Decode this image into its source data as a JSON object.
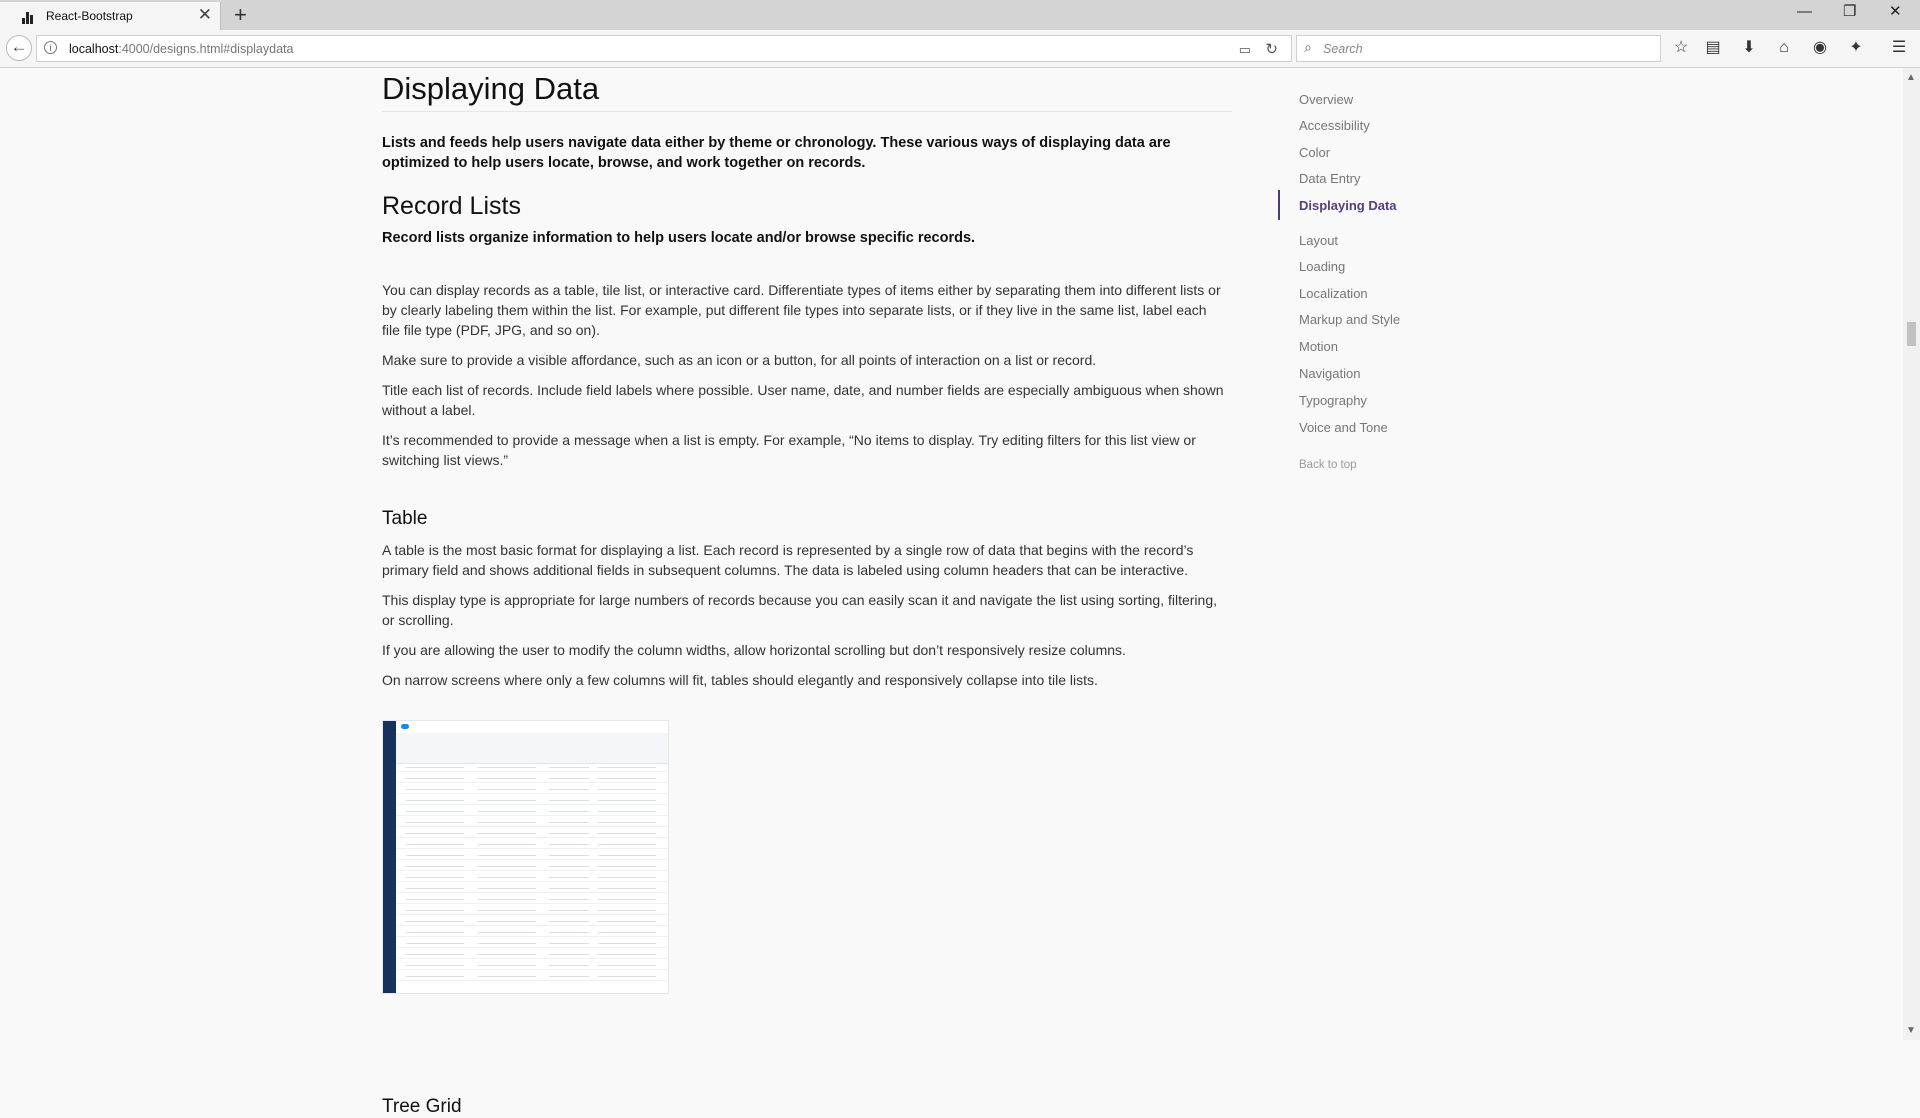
{
  "browser": {
    "tab_title": "React-Bootstrap",
    "url_host": "localhost",
    "url_rest": ":4000/designs.html#displaydata",
    "search_placeholder": "Search"
  },
  "page": {
    "title": "Displaying Data",
    "lead": "Lists and feeds help users navigate data either by theme or chronology. These various ways of displaying data are optimized to help users locate, browse, and work together on records.",
    "section_title": "Record Lists",
    "section_lead": "Record lists organize information to help users locate and/or browse specific records.",
    "record_paragraphs": [
      "You can display records as a table, tile list, or interactive card. Differentiate types of items either by separating them into different lists or by clearly labeling them within the list. For example, put different file types into separate lists, or if they live in the same list, label each file file type (PDF, JPG, and so on).",
      "Make sure to provide a visible affordance, such as an icon or a button, for all points of interaction on a list or record.",
      "Title each list of records. Include field labels where possible. User name, date, and number fields are especially ambiguous when shown without a label.",
      "It’s recommended to provide a message when a list is empty. For example, “No items to display. Try editing filters for this list view or switching list views.”"
    ],
    "table_title": "Table",
    "table_paragraphs": [
      "A table is the most basic format for displaying a list. Each record is represented by a single row of data that begins with the record’s primary field and shows additional fields in subsequent columns. The data is labeled using column headers that can be interactive.",
      "This display type is appropriate for large numbers of records because you can easily scan it and navigate the list using sorting, filtering, or scrolling.",
      "If you are allowing the user to modify the column widths, allow horizontal scrolling but don’t responsively resize columns.",
      "On narrow screens where only a few columns will fit, tables should elegantly and responsively collapse into tile lists."
    ],
    "next_heading": "Tree Grid"
  },
  "toc": {
    "items": [
      "Overview",
      "Accessibility",
      "Color",
      "Data Entry",
      "Displaying Data",
      "Layout",
      "Loading",
      "Localization",
      "Markup and Style",
      "Motion",
      "Navigation",
      "Typography",
      "Voice and Tone"
    ],
    "active": "Displaying Data",
    "back_to_top": "Back to top"
  },
  "colors": {
    "accent": "#563d7c",
    "brand_sidebar": "#16325c",
    "brand_blue": "#1589ee"
  }
}
